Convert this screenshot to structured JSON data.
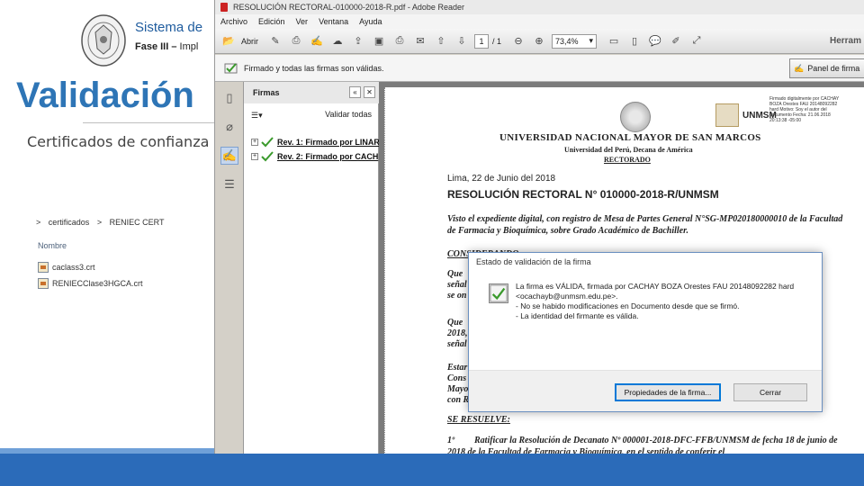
{
  "slide": {
    "header_title": "Sistema de",
    "subtitle_bold": "Fase III –",
    "subtitle_rest": " Impl",
    "big_title": "Validación",
    "section_label": "Certificados de confianza"
  },
  "explorer": {
    "breadcrumb": [
      ">",
      "certificados",
      ">",
      "RENIEC CERT"
    ],
    "column_header": "Nombre",
    "files": [
      "caclass3.crt",
      "RENIECClase3HGCA.crt"
    ]
  },
  "reader": {
    "title": "RESOLUCIÓN RECTORAL-010000-2018-R.pdf - Adobe Reader",
    "menu": [
      "Archivo",
      "Edición",
      "Ver",
      "Ventana",
      "Ayuda"
    ],
    "toolbar": {
      "open_label": "Abrir",
      "page_current": "1",
      "page_total": "/ 1",
      "zoom": "73,4%",
      "tools_label": "Herram"
    },
    "signature_bar": {
      "message": "Firmado y todas las firmas son válidas.",
      "panel_button": "Panel de firma"
    },
    "signatures_panel": {
      "title": "Firmas",
      "validate_all": "Validar todas",
      "rows": [
        {
          "label": "Rev. 1: Firmado por LINAR"
        },
        {
          "label": "Rev. 2: Firmado por CACH"
        }
      ]
    },
    "document": {
      "stamp_text": "Firmado digitalmente por CACHAY BOZA Orestes FAU 20148092282 hard Motivo: Soy el autor del documento Fecha: 21.06.2018 20:13:38 -05:00",
      "unmsm_logo": "UNMSM",
      "university": "UNIVERSIDAD NACIONAL MAYOR DE SAN MARCOS",
      "university_sub": "Universidad del Perú, Decana de América",
      "office": "RECTORADO",
      "date": "Lima, 22 de Junio del 2018",
      "resolution": "RESOLUCIÓN RECTORAL N° 010000-2018-R/UNMSM",
      "visto": "Visto el expediente digital, con registro de Mesa de Partes General N°SG-MP020180000010 de la Facultad de Farmacia y Bioquímica, sobre Grado Académico de Bachiller.",
      "considerando": "CONSIDERANDO:",
      "fragments": [
        "Que",
        "señal",
        "se on",
        "Que",
        "2018,",
        "señal",
        "Estar",
        "Cons",
        "Mayo",
        "con R"
      ],
      "se_resuelve": "SE RESUELVE:",
      "article_num": "1º",
      "article_text": "Ratificar la Resolución de Decanato Nº 000001-2018-DFC-FFB/UNMSM de fecha 18 de junio de 2018 de la Facultad de Farmacia y Bioquímica, en el sentido de conferir el"
    }
  },
  "dialog": {
    "title": "Estado de validación de la firma",
    "line1": "La firma es VÁLIDA, firmada por CACHAY BOZA Orestes FAU 20148092282 hard",
    "line2": "<ocachayb@unmsm.edu.pe>.",
    "line3": "- No se habido modificaciones en Documento desde que se firmó.",
    "line4": "- La identidad del firmante es válida.",
    "properties_button": "Propiedades de la firma...",
    "close_button": "Cerrar"
  },
  "colors": {
    "accent": "#2e75b6",
    "band": "#2b6bb9",
    "check_green": "#3a9a2c"
  }
}
